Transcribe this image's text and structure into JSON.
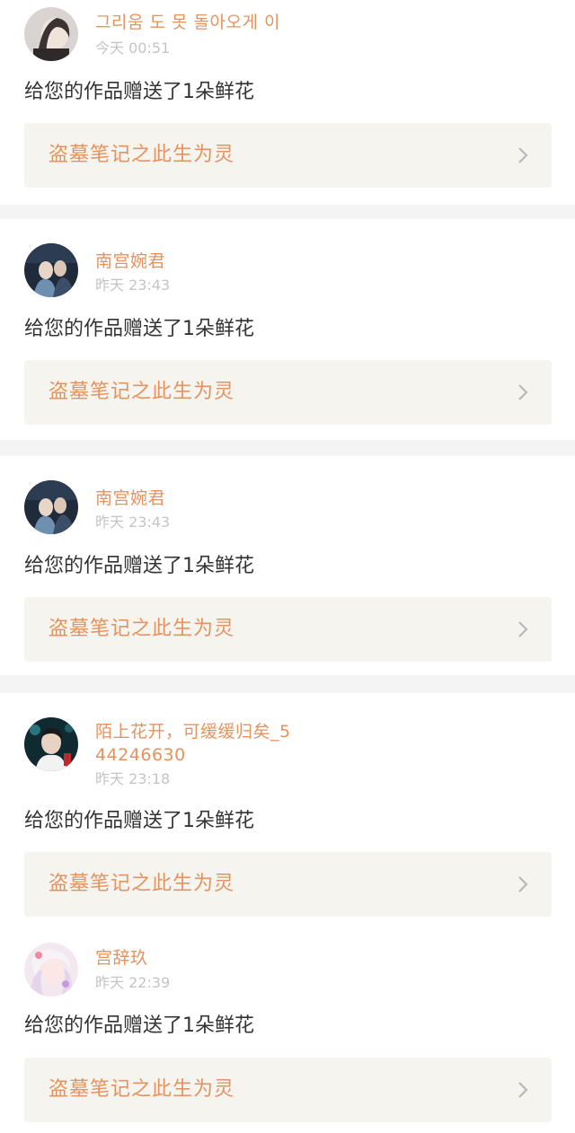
{
  "notifications": [
    {
      "username": "그리움 도 못 돌아오게 이",
      "time": "今天 00:51",
      "message": "给您的作品赠送了1朵鲜花",
      "work_title": "盗墓笔记之此生为灵"
    },
    {
      "username": "南宫婉君",
      "time": "昨天 23:43",
      "message": "给您的作品赠送了1朵鲜花",
      "work_title": "盗墓笔记之此生为灵"
    },
    {
      "username": "南宫婉君",
      "time": "昨天 23:43",
      "message": "给您的作品赠送了1朵鲜花",
      "work_title": "盗墓笔记之此生为灵"
    },
    {
      "username": "陌上花开，可缓缓归矣_544246630",
      "time": "昨天 23:18",
      "message": "给您的作品赠送了1朵鲜花",
      "work_title": "盗墓笔记之此生为灵"
    },
    {
      "username": "宫辞玖",
      "time": "昨天 22:39",
      "message": "给您的作品赠送了1朵鲜花",
      "work_title": "盗墓笔记之此生为灵"
    }
  ],
  "icons": {
    "chevron": "chevron-right-icon"
  },
  "colors": {
    "accent": "#e6925f",
    "card_bg": "#f5f4ef",
    "separator": "#f4f4f4",
    "muted": "#c4c4c4",
    "text": "#333333"
  }
}
